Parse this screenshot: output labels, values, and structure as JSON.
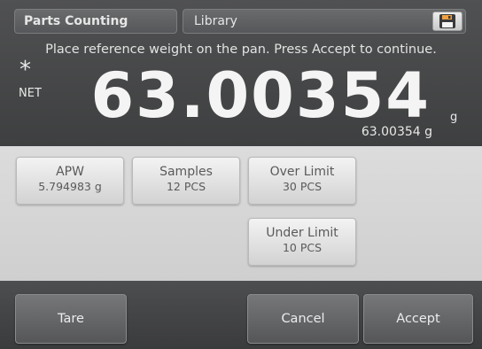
{
  "header": {
    "mode": "Parts Counting",
    "library": "Library",
    "save_icon": "floppy-disk-icon"
  },
  "prompt": "Place reference weight on the pan.  Press Accept to continue.",
  "display": {
    "stability_indicator": "*",
    "net_label": "NET",
    "weight": "63.00354",
    "unit": "g",
    "secondary_weight": "63.00354 g"
  },
  "params": {
    "apw": {
      "label": "APW",
      "value": "5.794983 g"
    },
    "samples": {
      "label": "Samples",
      "value": "12 PCS"
    },
    "over_limit": {
      "label": "Over Limit",
      "value": "30 PCS"
    },
    "under_limit": {
      "label": "Under Limit",
      "value": "10 PCS"
    }
  },
  "buttons": {
    "tare": "Tare",
    "cancel": "Cancel",
    "accept": "Accept"
  }
}
